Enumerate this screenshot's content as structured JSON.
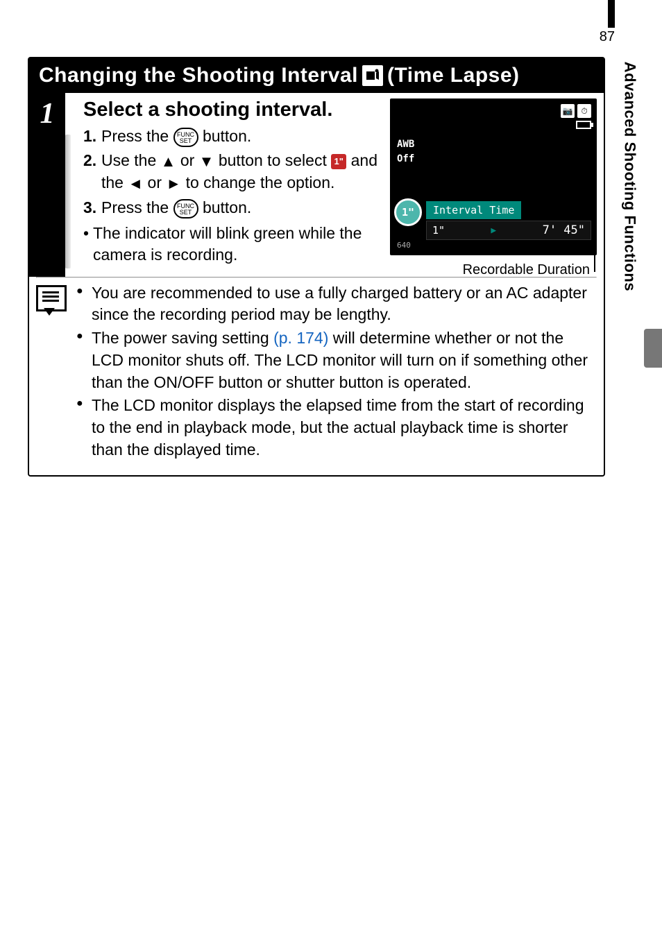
{
  "pageNumber": "87",
  "sideLabel": "Advanced Shooting Functions",
  "section": {
    "titleLeft": "Changing the Shooting Interval",
    "titleRight": "(Time Lapse)"
  },
  "step": {
    "number": "1",
    "heading": "Select a shooting interval.",
    "sub1_num": "1.",
    "sub1_a": "Press the ",
    "sub1_b": " button.",
    "sub2_num": "2.",
    "sub2_a": "Use the ",
    "sub2_b": " or ",
    "sub2_c": " button to select ",
    "sub2_d": " and the ",
    "sub2_e": " or ",
    "sub2_f": " to change the option.",
    "sub3_num": "3.",
    "sub3_a": "Press the ",
    "sub3_b": " button.",
    "indicatorNote": "The indicator will blink green while the camera is recording.",
    "secondIconLabel": "1\"",
    "func_top": "FUNC",
    "func_bot": "SET"
  },
  "screenshot": {
    "awb": "AWB",
    "off": "Off",
    "circle": "1\"",
    "intervalLabel": "Interval Time",
    "value": "1\"",
    "arrow": "▶",
    "duration": "7' 45\"",
    "res": "640"
  },
  "recDurLabel": "Recordable Duration",
  "notes": {
    "n1": "You are recommended to use a fully charged battery or an AC adapter since the recording period may be lengthy.",
    "n2_a": "The power saving setting ",
    "n2_link": "(p. 174)",
    "n2_b": " will determine whether or not the LCD monitor shuts off. The LCD monitor will turn on if something other than the ON/OFF button or shutter button is operated.",
    "n3": "The LCD monitor displays the elapsed time from the start of recording to the end in playback mode, but the actual playback time is shorter than the displayed time."
  },
  "arrows": {
    "up": "▲",
    "down": "▼",
    "left": "◄",
    "right": "►"
  }
}
